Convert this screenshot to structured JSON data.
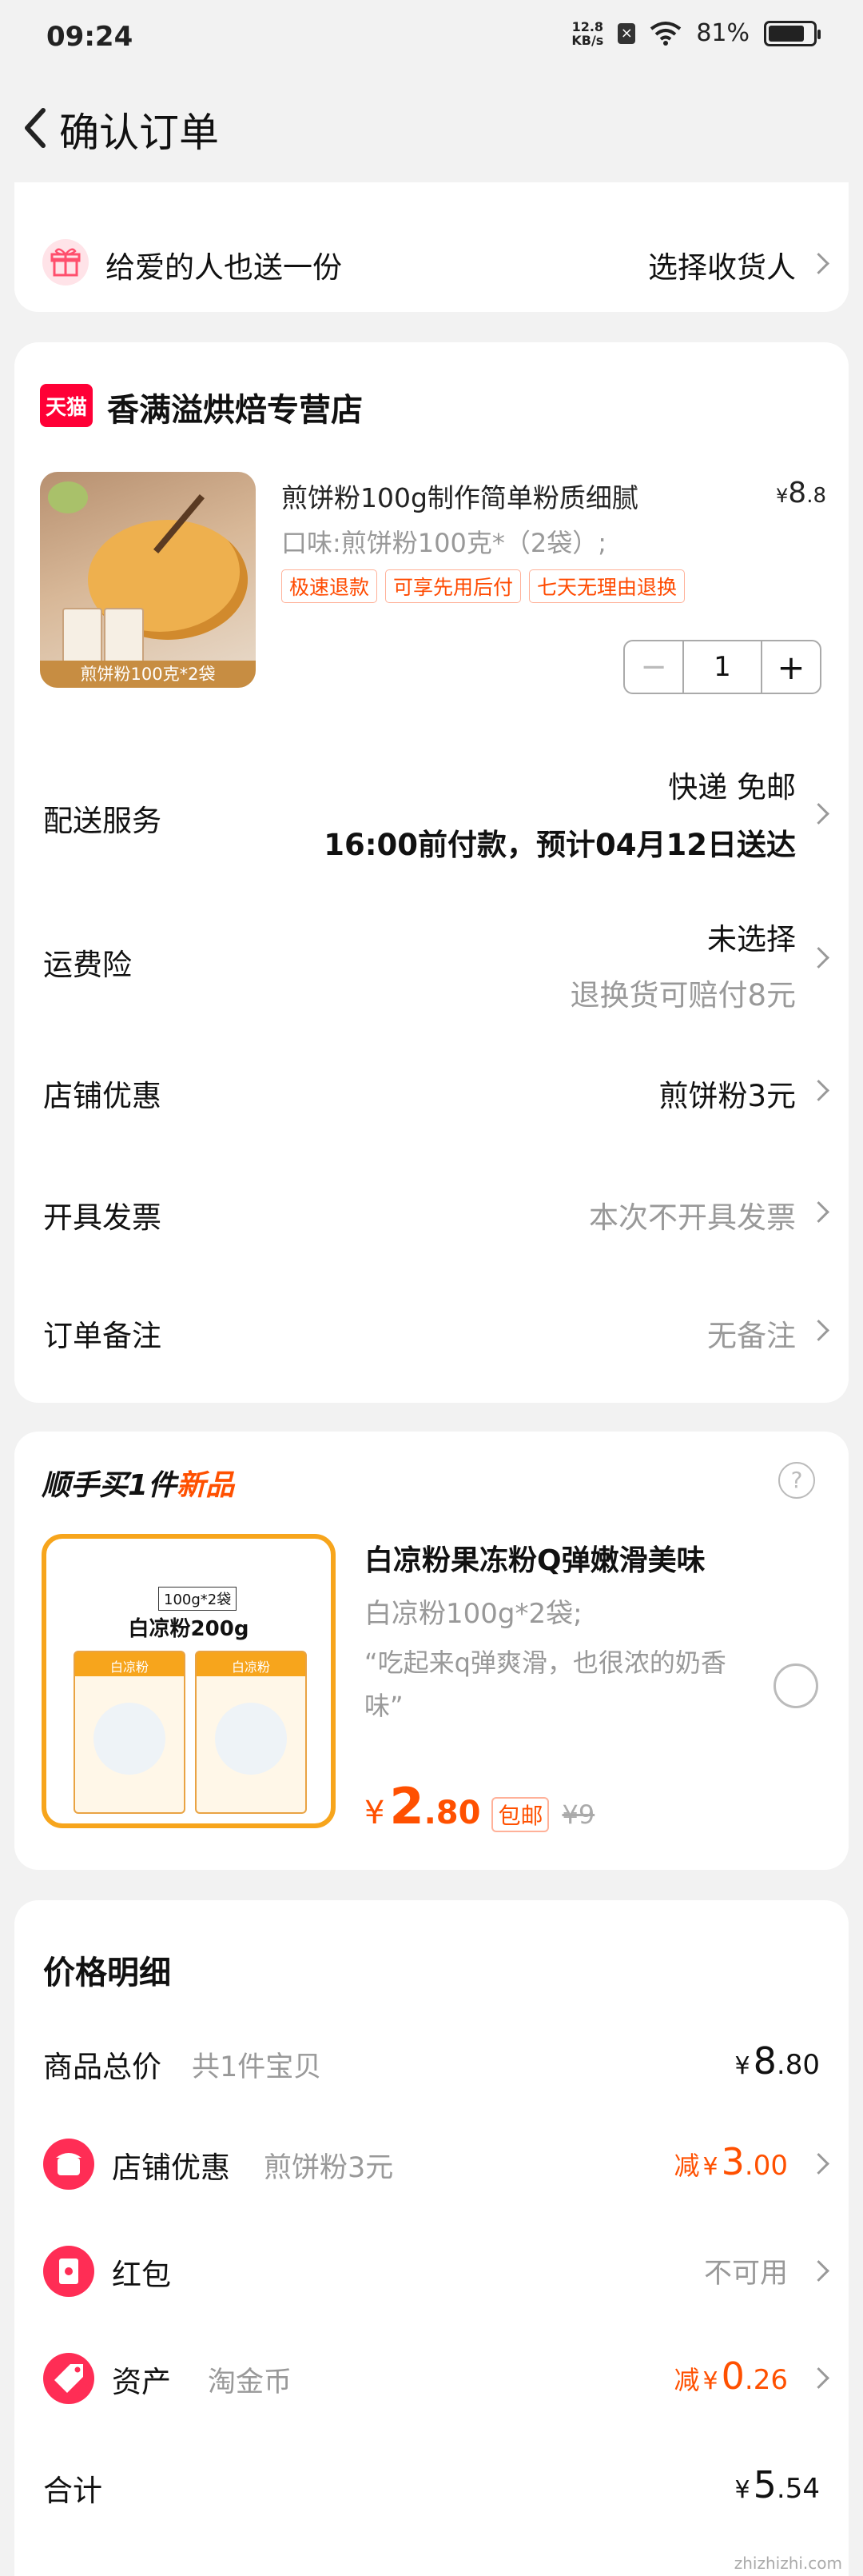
{
  "status_bar": {
    "time": "09:24",
    "speed_top": "12.8",
    "speed_bottom": "KB/s",
    "battery": "81%",
    "battery_level": 0.81
  },
  "nav": {
    "title": "确认订单"
  },
  "gift": {
    "label": "给爱的人也送一份",
    "action": "选择收货人"
  },
  "store": {
    "badge": "天猫",
    "name": "香满溢烘焙专营店",
    "product": {
      "title": "煎饼粉100g制作简单粉质细腻",
      "price_symbol": "¥",
      "price_int": "8",
      "price_dec": ".8",
      "spec": "口味:煎饼粉100克*（2袋）;",
      "tags": [
        "极速退款",
        "可享先用后付",
        "七天无理由退换"
      ],
      "image_caption": "煎饼粉100克*2袋",
      "quantity": "1",
      "minus": "−",
      "plus": "+"
    }
  },
  "rows": {
    "delivery": {
      "label": "配送服务",
      "line1": "快递 免邮",
      "line2": "16:00前付款，预计04月12日送达"
    },
    "insurance": {
      "label": "运费险",
      "line1": "未选择",
      "line2": "退换货可赔付8元"
    },
    "shop_discount": {
      "label": "店铺优惠",
      "value": "煎饼粉3元"
    },
    "invoice": {
      "label": "开具发票",
      "value": "本次不开具发票"
    },
    "note": {
      "label": "订单备注",
      "value": "无备注"
    }
  },
  "addon": {
    "title_prefix": "顺手买1件",
    "title_highlight": "新品",
    "help": "?",
    "product_name": "白凉粉果冻粉Q弹嫩滑美味",
    "spec": "白凉粉100g*2袋;",
    "quote": "“吃起来q弹爽滑，也很浓的奶香味”",
    "price_symbol": "¥",
    "price_int": "2",
    "price_dec": ".80",
    "free_ship": "包邮",
    "orig_price": "¥9",
    "image_badge": "100g*2袋",
    "image_title": "白凉粉200g",
    "pack_label": "白凉粉"
  },
  "price_detail": {
    "title": "价格明细",
    "total_goods": {
      "label": "商品总价",
      "sub": "共1件宝贝",
      "symbol": "¥",
      "int": "8",
      "dec": ".80"
    },
    "shop_discount": {
      "label": "店铺优惠",
      "sub": "煎饼粉3元",
      "prefix": "减",
      "symbol": "¥",
      "int": "3",
      "dec": ".00"
    },
    "red_packet": {
      "label": "红包",
      "value": "不可用"
    },
    "assets": {
      "label": "资产",
      "sub": "淘金币",
      "prefix": "减",
      "symbol": "¥",
      "int": "0",
      "dec": ".26"
    },
    "sum": {
      "label": "合计",
      "symbol": "¥",
      "int": "5",
      "dec": ".54"
    }
  },
  "watermark": "zhizhizhi.com",
  "colors": {
    "accent": "#ff5000",
    "tmall_red": "#ff0036",
    "gift_pink": "#ff4f6d"
  }
}
